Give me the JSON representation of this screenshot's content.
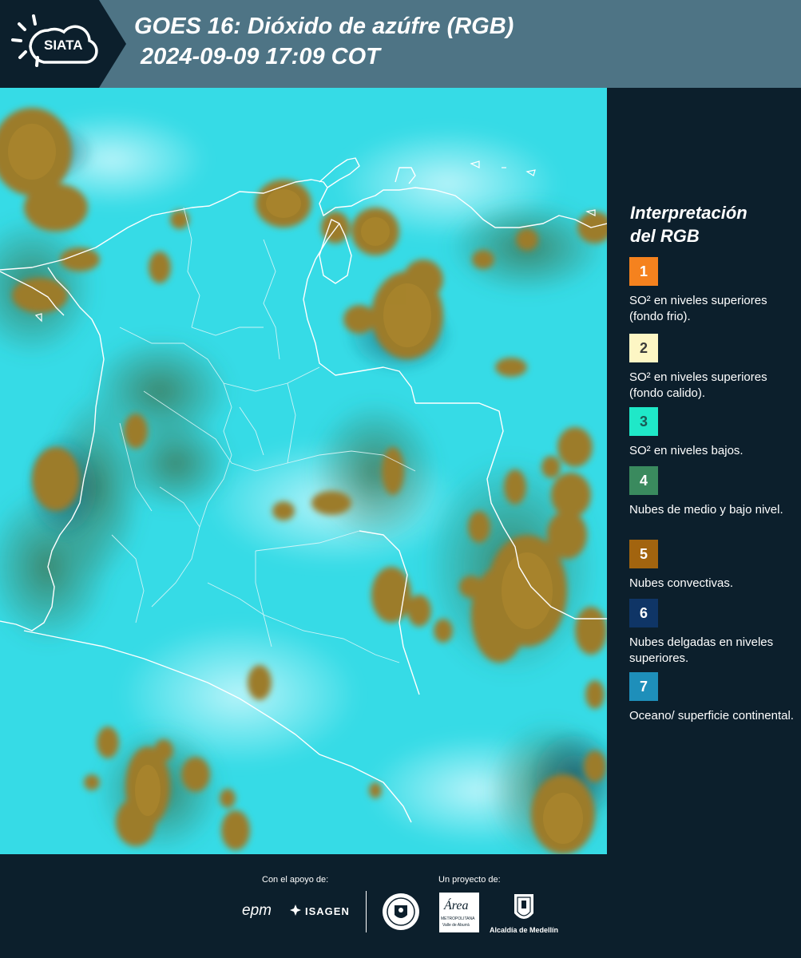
{
  "header": {
    "logo_text": "SIATA",
    "title_line1": "GOES 16: Dióxido de azúfre (RGB)",
    "title_line2": "2024-09-09 17:09 COT"
  },
  "legend": {
    "title_line1": "Interpretación",
    "title_line2": "del RGB",
    "items": [
      {
        "number": "1",
        "color": "#f5821e",
        "text_color": "#ffffff",
        "label": "SO² en niveles superiores (fondo frio)."
      },
      {
        "number": "2",
        "color": "#fdf6c4",
        "text_color": "#3a3a3a",
        "label": "SO² en niveles superiores (fondo calido)."
      },
      {
        "number": "3",
        "color": "#1fe8c8",
        "text_color": "#1a5a55",
        "label": "SO² en niveles bajos."
      },
      {
        "number": "4",
        "color": "#3a8a5e",
        "text_color": "#ffffff",
        "label": "Nubes de medio y bajo nivel."
      },
      {
        "number": "5",
        "color": "#a2640f",
        "text_color": "#ffffff",
        "label": "Nubes convectivas."
      },
      {
        "number": "6",
        "color": "#0f3566",
        "text_color": "#ffffff",
        "label": "Nubes delgadas en niveles superiores."
      },
      {
        "number": "7",
        "color": "#1e8fba",
        "text_color": "#ffffff",
        "label": "Oceano/ superficie continental."
      }
    ]
  },
  "footer": {
    "support_caption": "Con el apoyo de:",
    "project_caption": "Un proyecto de:",
    "logo_epm": "epm",
    "logo_isagen": "ISAGEN",
    "logo_area": "Área",
    "logo_area_sub1": "METROPOLITANA",
    "logo_area_sub2": "Valle de Aburrá",
    "logo_alcaldia": "Alcaldía de Medellín"
  },
  "colors": {
    "background": "#0c1f2c",
    "header": "#4e7485",
    "sky": "#33dde8",
    "convective": "#9a7a2c",
    "midlevel": "#4e8a6a",
    "border_lines": "#ffffff"
  }
}
